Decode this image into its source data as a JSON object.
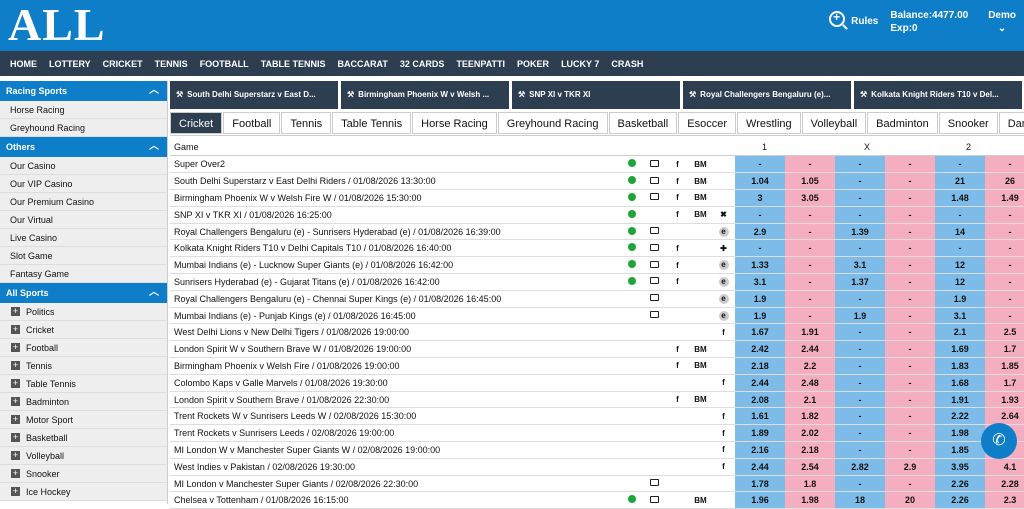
{
  "header": {
    "logo": "ALL",
    "rules": "Rules",
    "balance": "Balance:4477.00",
    "exposure": "Exp:0",
    "user": "Demo",
    "user_chevron": "⌄"
  },
  "nav": [
    "HOME",
    "LOTTERY",
    "CRICKET",
    "TENNIS",
    "FOOTBALL",
    "TABLE TENNIS",
    "BACCARAT",
    "32 CARDS",
    "TEENPATTI",
    "POKER",
    "LUCKY 7",
    "CRASH"
  ],
  "sidebar": {
    "racing": {
      "title": "Racing Sports",
      "items": [
        "Horse Racing",
        "Greyhound Racing"
      ]
    },
    "others": {
      "title": "Others",
      "items": [
        "Our Casino",
        "Our VIP Casino",
        "Our Premium Casino",
        "Our Virtual",
        "Live Casino",
        "Slot Game",
        "Fantasy Game"
      ]
    },
    "all": {
      "title": "All Sports",
      "items": [
        "Politics",
        "Cricket",
        "Football",
        "Tennis",
        "Table Tennis",
        "Badminton",
        "Motor Sport",
        "Basketball",
        "Volleyball",
        "Snooker",
        "Ice Hockey"
      ]
    }
  },
  "event_tabs": [
    "South Delhi Superstarz v East D...",
    "Birmingham Phoenix W v Welsh ...",
    "SNP XI v TKR XI",
    "Royal Challengers Bengaluru (e)...",
    "Kolkata Knight Riders T10 v Del..."
  ],
  "sport_tabs": [
    "Cricket",
    "Football",
    "Tennis",
    "Table Tennis",
    "Horse Racing",
    "Greyhound Racing",
    "Basketball",
    "Esoccer",
    "Wrestling",
    "Volleyball",
    "Badminton",
    "Snooker",
    "Darts"
  ],
  "game_header": {
    "game": "Game",
    "c1": "1",
    "cx": "X",
    "c2": "2"
  },
  "rows": [
    {
      "name": "Super Over2",
      "dot": true,
      "tv": true,
      "f": "f",
      "bm": "BM",
      "e": "",
      "odds": [
        "-",
        "-",
        "-",
        "-",
        "-",
        "-"
      ]
    },
    {
      "name": "South Delhi Superstarz v East Delhi Riders / 01/08/2026 13:30:00",
      "dot": true,
      "tv": true,
      "f": "f",
      "bm": "BM",
      "e": "",
      "odds": [
        "1.04",
        "1.05",
        "-",
        "-",
        "21",
        "26"
      ]
    },
    {
      "name": "Birmingham Phoenix W v Welsh Fire W / 01/08/2026 15:30:00",
      "dot": true,
      "tv": true,
      "f": "f",
      "bm": "BM",
      "e": "",
      "odds": [
        "3",
        "3.05",
        "-",
        "-",
        "1.48",
        "1.49"
      ]
    },
    {
      "name": "SNP XI v TKR XI / 01/08/2026 16:25:00",
      "dot": true,
      "tv": false,
      "f": "f",
      "bm": "BM",
      "e": "✖",
      "odds": [
        "-",
        "-",
        "-",
        "-",
        "-",
        "-"
      ]
    },
    {
      "name": "Royal Challengers Bengaluru (e) - Sunrisers Hyderabad (e) / 01/08/2026 16:39:00",
      "dot": true,
      "tv": true,
      "f": "",
      "bm": "",
      "e": "e",
      "odds": [
        "2.9",
        "-",
        "1.39",
        "-",
        "14",
        "-"
      ]
    },
    {
      "name": "Kolkata Knight Riders T10 v Delhi Capitals T10 / 01/08/2026 16:40:00",
      "dot": true,
      "tv": true,
      "f": "f",
      "bm": "",
      "e": "✚",
      "odds": [
        "-",
        "-",
        "-",
        "-",
        "-",
        "-"
      ]
    },
    {
      "name": "Mumbai Indians (e) - Lucknow Super Giants (e) / 01/08/2026 16:42:00",
      "dot": true,
      "tv": true,
      "f": "f",
      "bm": "",
      "e": "e",
      "odds": [
        "1.33",
        "-",
        "3.1",
        "-",
        "12",
        "-"
      ]
    },
    {
      "name": "Sunrisers Hyderabad (e) - Gujarat Titans (e) / 01/08/2026 16:42:00",
      "dot": true,
      "tv": true,
      "f": "f",
      "bm": "",
      "e": "e",
      "odds": [
        "3.1",
        "-",
        "1.37",
        "-",
        "12",
        "-"
      ]
    },
    {
      "name": "Royal Challengers Bengaluru (e) - Chennai Super Kings (e) / 01/08/2026 16:45:00",
      "dot": false,
      "tv": true,
      "f": "",
      "bm": "",
      "e": "e",
      "odds": [
        "1.9",
        "-",
        "-",
        "-",
        "1.9",
        "-"
      ]
    },
    {
      "name": "Mumbai Indians (e) - Punjab Kings (e) / 01/08/2026 16:45:00",
      "dot": false,
      "tv": true,
      "f": "",
      "bm": "",
      "e": "e",
      "odds": [
        "1.9",
        "-",
        "1.9",
        "-",
        "3.1",
        "-"
      ]
    },
    {
      "name": "West Delhi Lions v New Delhi Tigers / 01/08/2026 19:00:00",
      "dot": false,
      "tv": false,
      "f": "",
      "bm": "",
      "e": "f",
      "odds": [
        "1.67",
        "1.91",
        "-",
        "-",
        "2.1",
        "2.5"
      ]
    },
    {
      "name": "London Spirit W v Southern Brave W / 01/08/2026 19:00:00",
      "dot": false,
      "tv": false,
      "f": "f",
      "bm": "BM",
      "e": "",
      "odds": [
        "2.42",
        "2.44",
        "-",
        "-",
        "1.69",
        "1.7"
      ]
    },
    {
      "name": "Birmingham Phoenix v Welsh Fire / 01/08/2026 19:00:00",
      "dot": false,
      "tv": false,
      "f": "f",
      "bm": "BM",
      "e": "",
      "odds": [
        "2.18",
        "2.2",
        "-",
        "-",
        "1.83",
        "1.85"
      ]
    },
    {
      "name": "Colombo Kaps v Galle Marvels / 01/08/2026 19:30:00",
      "dot": false,
      "tv": false,
      "f": "",
      "bm": "",
      "e": "f",
      "odds": [
        "2.44",
        "2.48",
        "-",
        "-",
        "1.68",
        "1.7"
      ]
    },
    {
      "name": "London Spirit v Southern Brave / 01/08/2026 22:30:00",
      "dot": false,
      "tv": false,
      "f": "f",
      "bm": "BM",
      "e": "",
      "odds": [
        "2.08",
        "2.1",
        "-",
        "-",
        "1.91",
        "1.93"
      ]
    },
    {
      "name": "Trent Rockets W v Sunrisers Leeds W / 02/08/2026 15:30:00",
      "dot": false,
      "tv": false,
      "f": "",
      "bm": "",
      "e": "f",
      "odds": [
        "1.61",
        "1.82",
        "-",
        "-",
        "2.22",
        "2.64"
      ]
    },
    {
      "name": "Trent Rockets v Sunrisers Leeds / 02/08/2026 19:00:00",
      "dot": false,
      "tv": false,
      "f": "",
      "bm": "",
      "e": "f",
      "odds": [
        "1.89",
        "2.02",
        "-",
        "-",
        "1.98",
        "-"
      ]
    },
    {
      "name": "MI London W v Manchester Super Giants W / 02/08/2026 19:00:00",
      "dot": false,
      "tv": false,
      "f": "",
      "bm": "",
      "e": "f",
      "odds": [
        "2.16",
        "2.18",
        "-",
        "-",
        "1.85",
        "-"
      ]
    },
    {
      "name": "West Indies v Pakistan / 02/08/2026 19:30:00",
      "dot": false,
      "tv": false,
      "f": "",
      "bm": "",
      "e": "f",
      "odds": [
        "2.44",
        "2.54",
        "2.82",
        "2.9",
        "3.95",
        "4.1"
      ]
    },
    {
      "name": "MI London v Manchester Super Giants / 02/08/2026 22:30:00",
      "dot": false,
      "tv": true,
      "f": "",
      "bm": "",
      "e": "",
      "odds": [
        "1.78",
        "1.8",
        "-",
        "-",
        "2.26",
        "2.28"
      ]
    },
    {
      "name": "Chelsea v Tottenham / 01/08/2026 16:15:00",
      "dot": true,
      "tv": true,
      "f": "",
      "bm": "BM",
      "e": "",
      "odds": [
        "1.96",
        "1.98",
        "18",
        "20",
        "2.26",
        "2.3"
      ]
    }
  ],
  "colors": {
    "header": "#0e7ec9",
    "nav": "#2c3e50",
    "back": "#7dbbe8",
    "lay": "#f4aec0",
    "live": "#1fa43a"
  },
  "icons": {
    "whatsapp": "whatsapp-icon",
    "search": "search-plus-icon"
  }
}
